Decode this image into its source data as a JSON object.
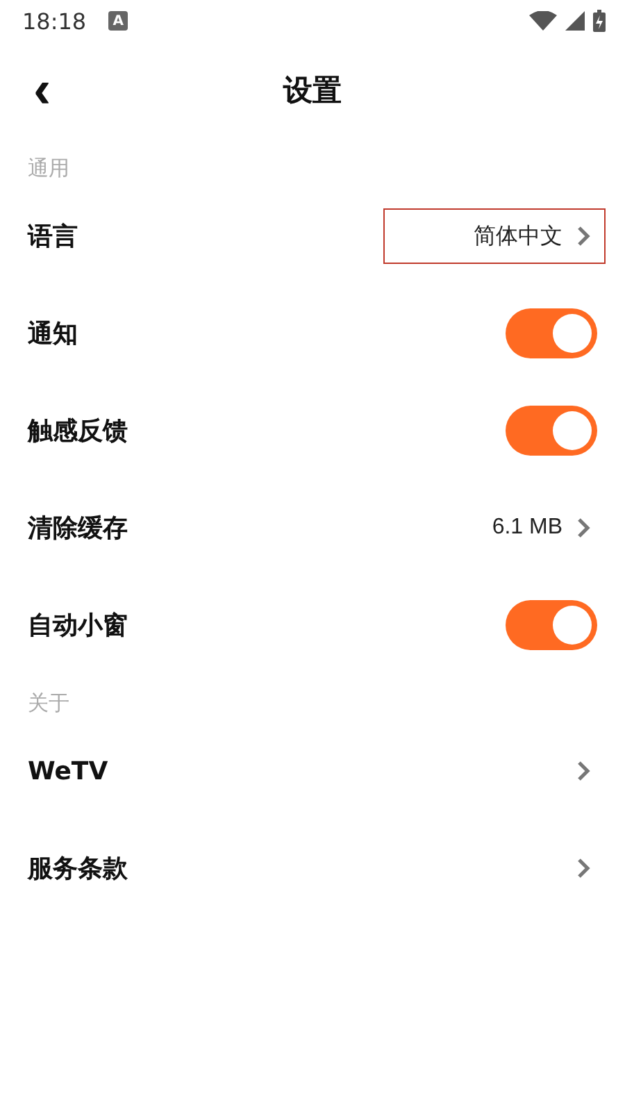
{
  "status_bar": {
    "time": "18:18",
    "badge": "A"
  },
  "header": {
    "back": "‹",
    "title": "设置"
  },
  "sections": [
    {
      "title": "通用",
      "items": [
        {
          "kind": "nav",
          "label": "语言",
          "value": "简体中文",
          "highlighted": true
        },
        {
          "kind": "toggle",
          "label": "通知",
          "on": true
        },
        {
          "kind": "toggle",
          "label": "触感反馈",
          "on": true
        },
        {
          "kind": "nav",
          "label": "清除缓存",
          "value": "6.1 MB",
          "highlighted": false
        },
        {
          "kind": "toggle",
          "label": "自动小窗",
          "on": true
        }
      ]
    },
    {
      "title": "关于",
      "items": [
        {
          "kind": "nav",
          "label": "WeTV",
          "highlighted": false
        },
        {
          "kind": "nav",
          "label": "服务条款",
          "highlighted": false
        }
      ]
    }
  ]
}
